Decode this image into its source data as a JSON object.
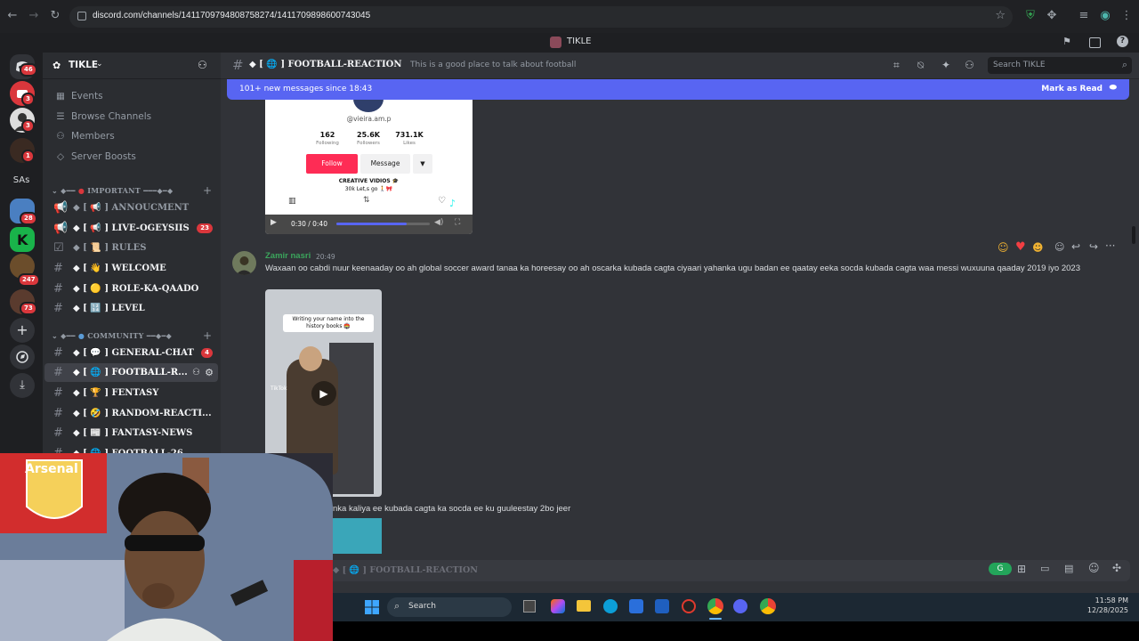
{
  "browser": {
    "url": "discord.com/channels/1411709794808758274/1411709898600743045"
  },
  "window": {
    "title": "TIKLE"
  },
  "rail": {
    "badges": [
      "46",
      "3",
      "3",
      "1",
      "28",
      "247",
      "73"
    ],
    "sas_label": "SAs"
  },
  "server": {
    "name": "TIKLE",
    "menu": [
      "Events",
      "Browse Channels",
      "Members",
      "Server Boosts"
    ],
    "categories": [
      "IMPORTANT",
      "COMMUNITY"
    ],
    "important_channels": [
      {
        "label": "◆ [ 📢 ] ANNOUCMENT",
        "count": ""
      },
      {
        "label": "◆ [ 📢 ] LIVE-OGEYSIIS",
        "count": "23"
      },
      {
        "label": "◆ [ 📜 ] RULES",
        "count": ""
      },
      {
        "label": "◆ [ 👋 ] WELCOME",
        "count": ""
      },
      {
        "label": "◆ [ 🟡 ] ROLE-KA-QAADO",
        "count": ""
      },
      {
        "label": "◆ [ 🔢 ] LEVEL",
        "count": ""
      }
    ],
    "community_channels": [
      {
        "label": "◆ [ 💬 ] GENERAL-CHAT",
        "count": "4"
      },
      {
        "label": "◆ [ 🌐 ] FOOTBALL-R...",
        "count": ""
      },
      {
        "label": "◆ [ 🏆 ] FENTASY",
        "count": ""
      },
      {
        "label": "◆ [ 🤣 ] RANDOM-REACTI...",
        "count": ""
      },
      {
        "label": "◆ [ 📰 ] FANTASY-NEWS",
        "count": ""
      },
      {
        "label": "◆ [ 🌐 ] FOOTBALL-26",
        "count": ""
      }
    ]
  },
  "header": {
    "channel": "◆ [ 🌐 ] FOOTBALL-REACTION",
    "topic": "This is a good place to talk about football",
    "search_placeholder": "Search TIKLE"
  },
  "newbar": {
    "text": "101+ new messages since 18:43",
    "action": "Mark as Read"
  },
  "tiktok_card": {
    "handle": "@vieira.am.p",
    "stats": [
      {
        "value": "162",
        "label": "Following"
      },
      {
        "value": "25.6K",
        "label": "Followers"
      },
      {
        "value": "731.1K",
        "label": "Likes"
      }
    ],
    "follow": "Follow",
    "message": "Message",
    "bio1": "CREATIVE VIDIOS 🎓",
    "bio2": "30k Let,s go 🚶🎀",
    "time": "0:30 / 0:40"
  },
  "message": {
    "author": "Zamir nasri",
    "time": "20:49",
    "text": "Waxaan oo cabdi nuur keenaaday oo ah global soccer award tanaa ka horeesay oo ah oscarka kubada cagta ciyaari yahanka ugu badan ee qaatay eeka socda kubada cagta waa messi wuxuuna qaaday 2019 iyo 2023",
    "video_caption": "Writing your name into the history books 🏟️",
    "tiktok_tag": "TikTok",
    "reply_text": "nka kaliya ee kubada cagta ka socda ee ku guuleestay 2bo jeer"
  },
  "composer": {
    "placeholder": "◆ [ 🌐 ] FOOTBALL-REACTION"
  },
  "taskbar": {
    "search": "Search",
    "time": "11:58 PM",
    "date": "12/28/2025"
  },
  "colors": {
    "blurple": "#5865f2",
    "author": "#3ba55c",
    "red_badge": "#da373c",
    "follow_pink": "#fe2c55"
  }
}
